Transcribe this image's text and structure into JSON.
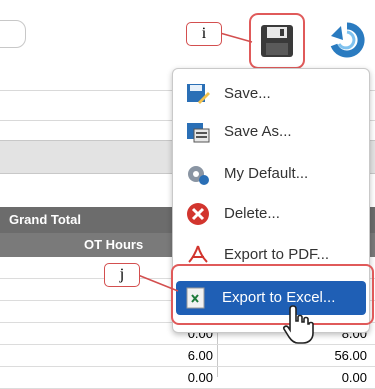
{
  "toolbar": {
    "save_icon": "floppy-disk-icon",
    "refresh_icon": "refresh-icon",
    "accent": "#1f5fb5",
    "highlight": "#e05a5a"
  },
  "annotations": {
    "i": "i",
    "j": "j"
  },
  "menu": {
    "items": [
      {
        "label": "Save...",
        "icon": "save-icon"
      },
      {
        "label": "Save As...",
        "icon": "save-as-icon"
      },
      {
        "label": "My Default...",
        "icon": "settings-gear-icon"
      },
      {
        "label": "Delete...",
        "icon": "delete-icon"
      },
      {
        "label": "Export to PDF...",
        "icon": "pdf-icon"
      },
      {
        "label": "Export to Excel...",
        "icon": "excel-icon"
      }
    ]
  },
  "table": {
    "group_header": "Grand Total",
    "column_header": "OT Hours",
    "rows": [
      {
        "c1": "0.00",
        "c2": "8.00"
      },
      {
        "c1": "6.00",
        "c2": "56.00"
      },
      {
        "c1": "0.00",
        "c2": "0.00"
      }
    ]
  }
}
